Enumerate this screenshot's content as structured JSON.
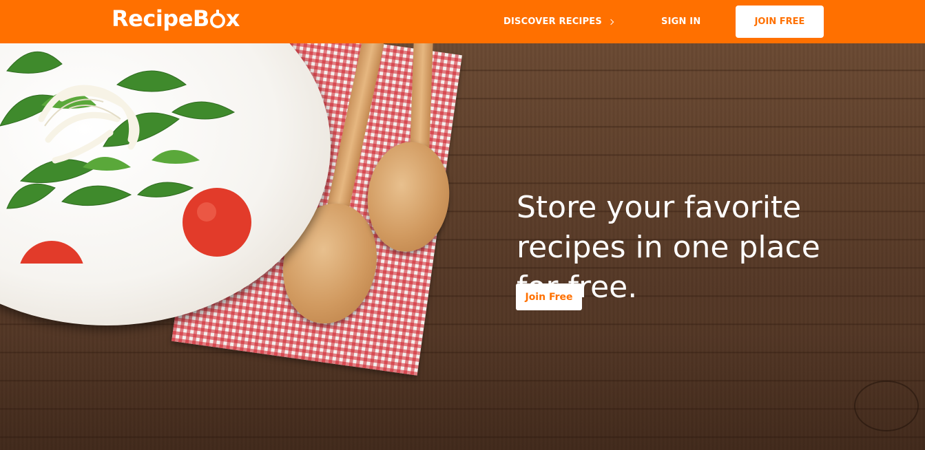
{
  "brand": {
    "name_prefix": "RecipeB",
    "name_suffix": "x",
    "icon": "pot-icon",
    "color": "#ff7000"
  },
  "nav": {
    "discover_label": "DISCOVER RECIPES",
    "discover_icon": "chevron-right-icon",
    "signin_label": "SIGN IN",
    "join_label": "JOIN FREE"
  },
  "hero": {
    "headline": "Store your favorite recipes in one place for free.",
    "cta_label": "Join Free"
  },
  "colors": {
    "accent": "#ff7000",
    "header_text": "#ffffff",
    "button_bg": "#ffffff"
  }
}
